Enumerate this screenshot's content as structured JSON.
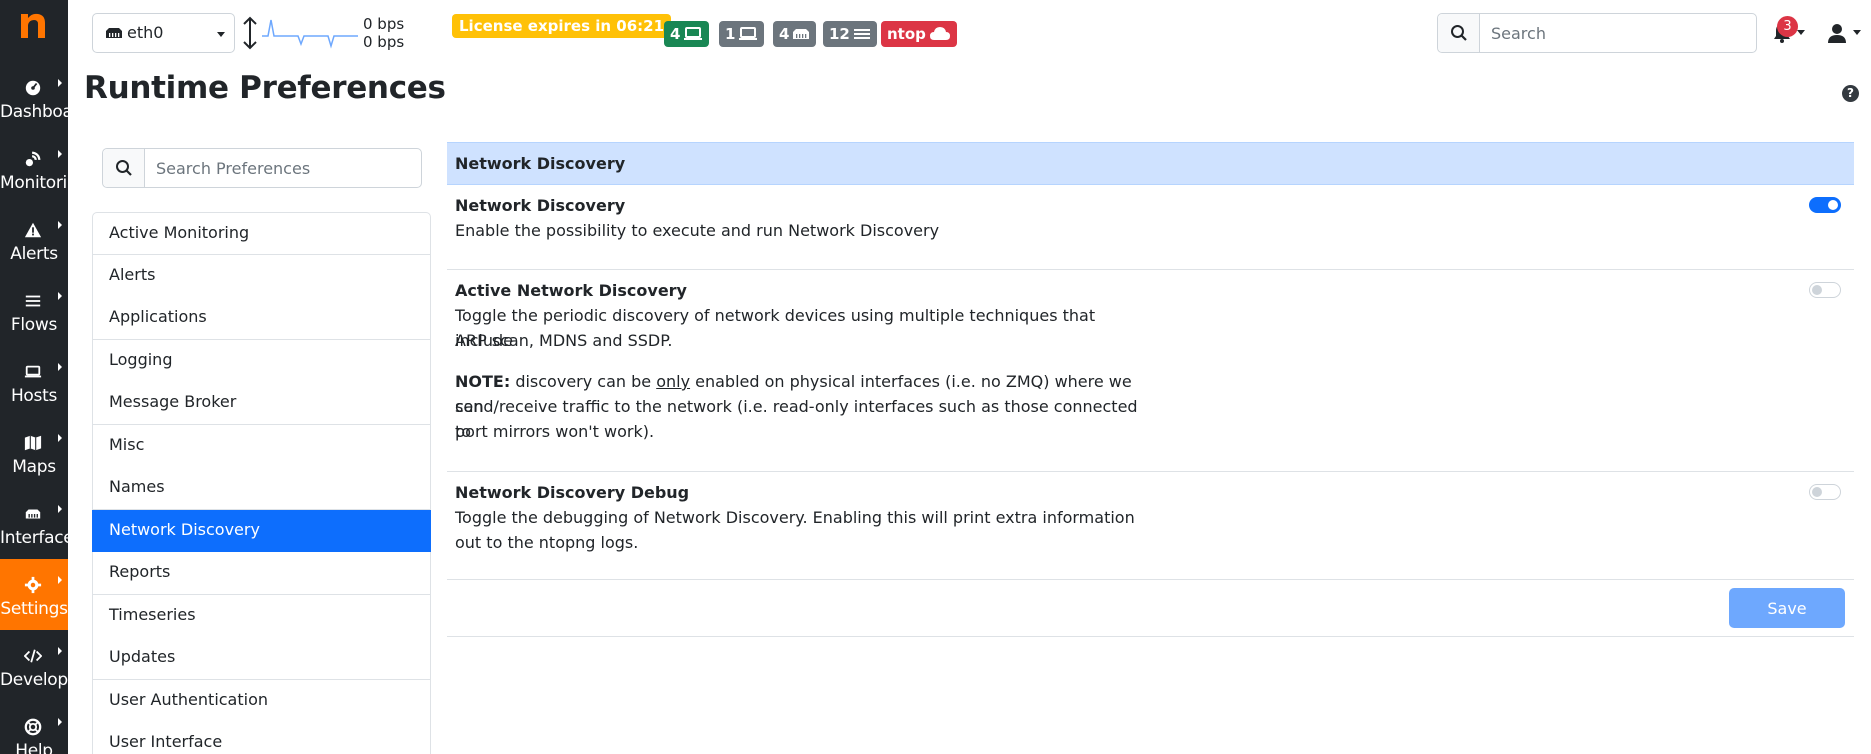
{
  "sidebar": {
    "items": [
      {
        "label": "Dashboard",
        "icon": "dashboard-icon"
      },
      {
        "label": "Monitoring",
        "icon": "monitoring-icon"
      },
      {
        "label": "Alerts",
        "icon": "alert-icon"
      },
      {
        "label": "Flows",
        "icon": "flows-icon"
      },
      {
        "label": "Hosts",
        "icon": "laptop-icon"
      },
      {
        "label": "Maps",
        "icon": "map-icon"
      },
      {
        "label": "Interfaces",
        "icon": "ethernet-icon"
      },
      {
        "label": "Settings",
        "icon": "gear-icon",
        "active": true
      },
      {
        "label": "Developer",
        "icon": "code-icon"
      },
      {
        "label": "Help",
        "icon": "lifering-icon"
      }
    ]
  },
  "topbar": {
    "interface": "eth0",
    "bps_upload": "0 bps",
    "bps_download": "0 bps",
    "license": "License expires in 06:21",
    "badges": {
      "hosts_local": "4",
      "hosts_remote": "1",
      "devices": "4",
      "flows": "12",
      "ntop": "ntop"
    },
    "search_placeholder": "Search",
    "alert_count": "3"
  },
  "page": {
    "title": "Runtime Preferences",
    "help": "?"
  },
  "pref_search": {
    "placeholder": "Search Preferences"
  },
  "pref_menu": {
    "items": [
      "Active Monitoring",
      "Alerts",
      "Applications",
      "Logging",
      "Message Broker",
      "Misc",
      "Names",
      "Network Discovery",
      "Reports",
      "Timeseries",
      "Updates",
      "User Authentication",
      "User Interface"
    ],
    "active": "Network Discovery"
  },
  "panel": {
    "header": "Network Discovery",
    "rows": [
      {
        "title": "Network Discovery",
        "desc": "Enable the possibility to execute and run Network Discovery",
        "enabled": true
      },
      {
        "title": "Active Network Discovery",
        "desc_1": "Toggle the periodic discovery of network devices using multiple techniques that include",
        "desc_2": "ARP scan, MDNS and SSDP.",
        "note_label": "NOTE:",
        "note_1a": " discovery can be ",
        "note_1b": "only",
        "note_1c": " enabled on physical interfaces (i.e. no ZMQ) where we can",
        "note_2": "send/receive traffic to the network (i.e. read-only interfaces such as those connected to",
        "note_3": "port mirrors won't work).",
        "enabled": false
      },
      {
        "title": "Network Discovery Debug",
        "desc_1": "Toggle the debugging of Network Discovery. Enabling this will print extra information",
        "desc_2": "out to the ntopng logs.",
        "enabled": false
      }
    ],
    "save_label": "Save"
  },
  "colors": {
    "sidebar_bg": "#212529",
    "active_orange": "#ff7500",
    "primary": "#0d6efd",
    "header_bg": "#cfe2ff",
    "license": "#ffc107"
  }
}
